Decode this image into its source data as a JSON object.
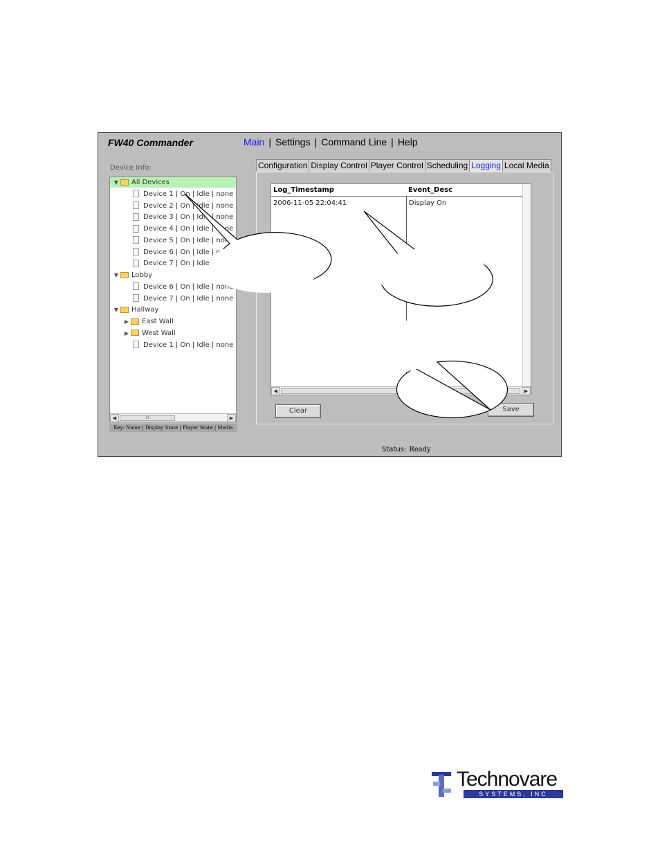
{
  "app": {
    "title": "FW40 Commander"
  },
  "menu": [
    {
      "label": "Main",
      "active": true
    },
    {
      "label": "Settings",
      "active": false
    },
    {
      "label": "Command Line",
      "active": false
    },
    {
      "label": "Help",
      "active": false
    }
  ],
  "device_panel": {
    "label": "Device Info:",
    "tree": [
      {
        "label": "All Devices",
        "type": "folder",
        "expanded": true,
        "selected": true
      },
      {
        "label": "Device 1 | On | Idle | none",
        "type": "device"
      },
      {
        "label": "Device 2 | On | Idle | none",
        "type": "device"
      },
      {
        "label": "Device 3 | On | Idle | none",
        "type": "device"
      },
      {
        "label": "Device 4 | On | Idle | none",
        "type": "device"
      },
      {
        "label": "Device 5 | On | Idle | none",
        "type": "device"
      },
      {
        "label": "Device 6 | On | Idle | none",
        "type": "device"
      },
      {
        "label": "Device 7 | On | Idle | none",
        "type": "device"
      },
      {
        "label": "Lobby",
        "type": "folder",
        "expanded": true
      },
      {
        "label": "Device 6 | On | Idle | none",
        "type": "device"
      },
      {
        "label": "Device 7 | On | Idle | none",
        "type": "device"
      },
      {
        "label": "Hallway",
        "type": "folder",
        "expanded": true
      },
      {
        "label": "East Wall",
        "type": "folder",
        "expanded": false
      },
      {
        "label": "West Wall",
        "type": "folder",
        "expanded": false
      },
      {
        "label": "Device 1 | On | Idle | none",
        "type": "device"
      }
    ],
    "key_text": "Key: Name | Display State | Player State | Media"
  },
  "tabs": [
    {
      "label": "Configuration",
      "active": false
    },
    {
      "label": "Display Control",
      "active": false
    },
    {
      "label": "Player Control",
      "active": false
    },
    {
      "label": "Scheduling",
      "active": false
    },
    {
      "label": "Logging",
      "active": true
    },
    {
      "label": "Local Media",
      "active": false
    }
  ],
  "log_table": {
    "columns": [
      "Log_Timestamp",
      "Event_Desc"
    ],
    "rows": [
      [
        "2006-11-05 22:04:41",
        "Display On"
      ]
    ]
  },
  "buttons": {
    "clear": "Clear",
    "save": "Save"
  },
  "status": {
    "label": "Status:",
    "value": "Ready"
  },
  "logo": {
    "name": "Technovare",
    "sub": "SYSTEMS, INC"
  },
  "colors": {
    "accent": "#1a1aff",
    "selected": "#b5f2b3",
    "window_bg": "#bdbdbd",
    "logo_blue": "#2b3a9b"
  }
}
